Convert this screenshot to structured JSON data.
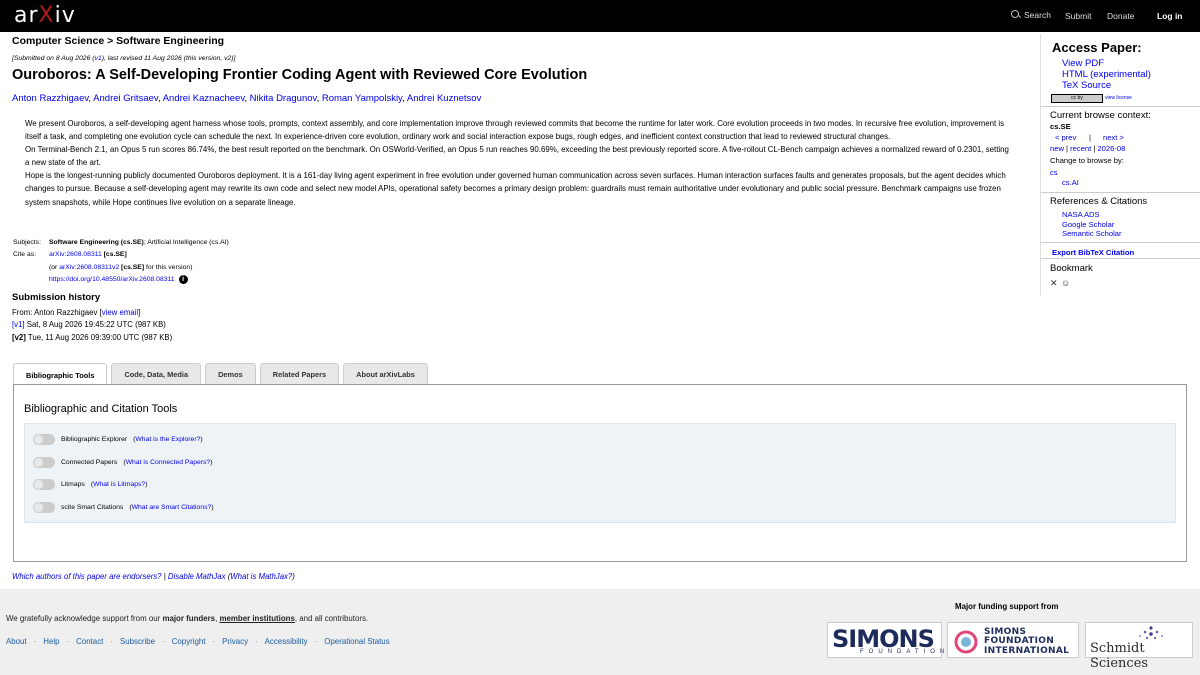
{
  "header": {
    "logo": "arXiv",
    "nav": [
      "Search",
      "Submit",
      "Donate",
      "Log in"
    ]
  },
  "breadcrumb": "Computer Science > Software Engineering",
  "dateline": {
    "prefix": "[Submitted on 8 Aug 2026 (",
    "v1": "v1",
    "suffix": "), last revised 11 Aug 2026 (this version, v2)]"
  },
  "title": "Ouroboros: A Self-Developing Frontier Coding Agent with Reviewed Core Evolution",
  "authors": [
    "Anton Razzhigaev",
    "Andrei Gritsaev",
    "Andrei Kaznacheev",
    "Nikita Dragunov",
    "Roman Yampolskiy",
    "Andrei Kuznetsov"
  ],
  "abstract": [
    "We present Ouroboros, a self-developing agent harness whose tools, prompts, context assembly, and core implementation improve through reviewed commits that become the runtime for later work. Core evolution proceeds in two modes. In recursive free evolution, improvement is itself a task, and completing one evolution cycle can schedule the next. In experience-driven core evolution, ordinary work and social interaction expose bugs, rough edges, and inefficient context construction that lead to reviewed structural changes.",
    "On Terminal-Bench 2.1, an Opus 5 run scores 86.74%, the best result reported on the benchmark. On OSWorld-Verified, an Opus 5 run reaches 90.69%, exceeding the best previously reported score. A five-rollout CL-Bench campaign achieves a normalized reward of 0.2301, setting a new state of the art.",
    "Hope is the longest-running publicly documented Ouroboros deployment. It is a 161-day living agent experiment in free evolution under governed human communication across seven surfaces. Human interaction surfaces faults and generates proposals, but the agent decides which changes to pursue. Because a self-developing agent may rewrite its own code and select new model APIs, operational safety becomes a primary design problem: guardrails must remain authoritative under evolutionary and public social pressure. Benchmark campaigns use frozen system snapshots, while Hope continues live evolution on a separate lineage."
  ],
  "meta": {
    "subjects_label": "Subjects:",
    "subjects_main": "Software Engineering (cs.SE)",
    "subjects_rest": "; Artificial Intelligence (cs.AI)",
    "cite_label": "Cite as:",
    "cite_id": "arXiv:2608.08311",
    "cite_cat": " [cs.SE]",
    "cite_v_pre": "(or ",
    "cite_v_id": "arXiv:2608.08311v2",
    "cite_v_cat": " [cs.SE]",
    "cite_v_post": " for this version)",
    "doi": "https://doi.org/10.48550/arXiv.2608.08311"
  },
  "submission": {
    "title": "Submission history",
    "from_pre": "From: Anton Razzhigaev [",
    "from_link": "view email",
    "from_post": "]",
    "v1_tag": "[v1]",
    "v1_text": " Sat, 8 Aug 2026 19:45:22 UTC (987 KB)",
    "v2_tag": "[v2]",
    "v2_text": " Tue, 11 Aug 2026 09:39:00 UTC (987 KB)"
  },
  "tabs": [
    "Bibliographic Tools",
    "Code, Data, Media",
    "Demos",
    "Related Papers",
    "About arXivLabs"
  ],
  "panel": {
    "heading": "Bibliographic and Citation Tools",
    "tools": [
      {
        "name": "Bibliographic Explorer",
        "link": "What is the Explorer?"
      },
      {
        "name": "Connected Papers",
        "link": "What is Connected Papers?"
      },
      {
        "name": "Litmaps",
        "link": "What is Litmaps?"
      },
      {
        "name": "scite Smart Citations",
        "link": "What are Smart Citations?"
      }
    ]
  },
  "endorse": {
    "a": "Which authors of this paper are endorsers?",
    "sep": " | ",
    "b": "Disable MathJax",
    "c": " (",
    "d": "What is MathJax?",
    "e": ")"
  },
  "sidebar": {
    "access_title": "Access Paper:",
    "view_pdf": "View PDF",
    "html": "HTML (experimental)",
    "tex": "TeX Source",
    "cc": "cc by",
    "view_license": "view license",
    "context_title": "Current browse context:",
    "context_cat": "cs.SE",
    "prev": "< prev",
    "pipe": "|",
    "next": "next >",
    "new": "new",
    "recent": "recent",
    "month": "2026-08",
    "change_label": "Change to browse by:",
    "cs": "cs",
    "csai": "cs.AI",
    "refs_title": "References & Citations",
    "nasa": "NASA ADS",
    "google": "Google Scholar",
    "semantic": "Semantic Scholar",
    "bibtex": "Export BibTeX Citation",
    "bookmark": "Bookmark"
  },
  "footer": {
    "ack_pre": "We gratefully acknowledge support from our ",
    "ack_funders": "major funders",
    "ack_mid": ", ",
    "ack_members": "member institutions",
    "ack_post": ", and all contributors.",
    "links": [
      "About",
      "Help",
      "Contact",
      "Subscribe",
      "Copyright",
      "Privacy",
      "Accessibility",
      "Operational Status"
    ],
    "funding_title": "Major funding support from",
    "simons": "SIMONS",
    "simons_sub": "FOUNDATION",
    "sfi_1": "SIMONS",
    "sfi_2": "FOUNDATION",
    "sfi_3": "INTERNATIONAL",
    "schmidt": "Schmidt Sciences"
  },
  "colors": {
    "header_bg": "#000000",
    "arxiv_red": "#b31b1b",
    "link": "#0000ee",
    "footer_bg": "#efefef"
  }
}
